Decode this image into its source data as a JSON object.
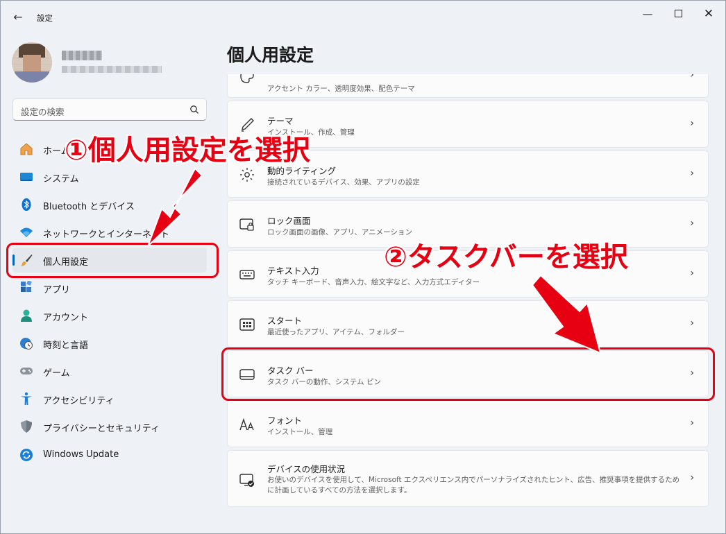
{
  "window": {
    "title": "設定"
  },
  "profile": {
    "name": "",
    "email": ""
  },
  "search": {
    "placeholder": "設定の検索"
  },
  "sidebar": {
    "items": [
      {
        "label": "ホーム",
        "icon": "home-icon"
      },
      {
        "label": "システム",
        "icon": "monitor-icon"
      },
      {
        "label": "Bluetooth とデバイス",
        "icon": "bluetooth-icon"
      },
      {
        "label": "ネットワークとインターネット",
        "icon": "wifi-icon"
      },
      {
        "label": "個人用設定",
        "icon": "paintbrush-icon",
        "active": true
      },
      {
        "label": "アプリ",
        "icon": "apps-icon"
      },
      {
        "label": "アカウント",
        "icon": "person-icon"
      },
      {
        "label": "時刻と言語",
        "icon": "globe-clock-icon"
      },
      {
        "label": "ゲーム",
        "icon": "gamepad-icon"
      },
      {
        "label": "アクセシビリティ",
        "icon": "accessibility-icon"
      },
      {
        "label": "プライバシーとセキュリティ",
        "icon": "shield-icon"
      },
      {
        "label": "Windows Update",
        "icon": "update-icon"
      }
    ]
  },
  "main": {
    "title": "個人用設定",
    "cards": [
      {
        "title": "",
        "desc": "アクセント カラー、透明度効果、配色テーマ",
        "icon": "palette-icon"
      },
      {
        "title": "テーマ",
        "desc": "インストール、作成、管理",
        "icon": "pen-icon"
      },
      {
        "title": "動的ライティング",
        "desc": "接続されているデバイス、効果、アプリの設定",
        "icon": "lighting-icon"
      },
      {
        "title": "ロック画面",
        "desc": "ロック画面の画像、アプリ、アニメーション",
        "icon": "lock-screen-icon"
      },
      {
        "title": "テキスト入力",
        "desc": "タッチ キーボード、音声入力、絵文字など、入力方式エディター",
        "icon": "keyboard-icon"
      },
      {
        "title": "スタート",
        "desc": "最近使ったアプリ、アイテム、フォルダー",
        "icon": "start-icon"
      },
      {
        "title": "タスク バー",
        "desc": "タスク バーの動作、システム ピン",
        "icon": "taskbar-icon"
      },
      {
        "title": "フォント",
        "desc": "インストール、管理",
        "icon": "font-icon"
      },
      {
        "title": "デバイスの使用状況",
        "desc": "お使いのデバイスを使用して、Microsoft エクスペリエンス内でパーソナライズされたヒント、広告、推奨事項を提供するために計画しているすべての方法を選択します。",
        "icon": "device-usage-icon"
      }
    ]
  },
  "annotations": {
    "step1": "①個人用設定を選択",
    "step2": "②タスクバーを選択",
    "color": "#e60012"
  },
  "colors": {
    "accent": "#0067c0"
  }
}
